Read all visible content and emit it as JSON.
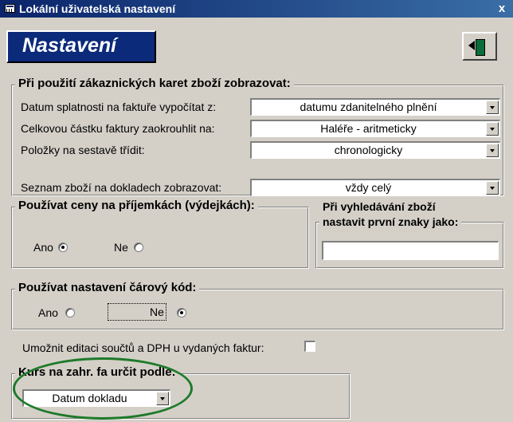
{
  "window": {
    "title": "Lokální uživatelská nastavení",
    "close_glyph": "x",
    "app_icon": "form-icon"
  },
  "header": {
    "title": "Nastavení",
    "exit_icon": "exit-door-icon"
  },
  "customer_cards_group": {
    "legend": "Při použití zákaznických karet zboží zobrazovat:",
    "rows": [
      {
        "label": "Datum splatnosti na faktuře vypočítat z:",
        "value": "datumu zdanitelného plnění"
      },
      {
        "label": "Celkovou částku faktury zaokrouhlit na:",
        "value": "Haléře - aritmeticky"
      },
      {
        "label": "Položky na sestavě třídit:",
        "value": "chronologicky"
      },
      {
        "label": "Seznam zboží na dokladech zobrazovat:",
        "value": "vždy celý"
      }
    ]
  },
  "prices_group": {
    "legend": "Používat ceny na příjemkách (výdejkách):",
    "yes_label": "Ano",
    "no_label": "Ne",
    "selected": "Ano"
  },
  "search_group": {
    "legend_line1": "Při vyhledávání zboží",
    "legend_line2": "nastavit první znaky jako:",
    "value": ""
  },
  "barcode_group": {
    "legend": "Používat nastavení čárový kód:",
    "yes_label": "Ano",
    "no_label": "Ne",
    "selected": "Ne"
  },
  "edit_totals": {
    "label": "Umožnit editaci součtů a DPH u vydaných faktur:",
    "checked": false
  },
  "exchange_group": {
    "legend": "Kurs na zahr. fa určit podle:",
    "value": "Datum dokladu"
  },
  "colors": {
    "title_bar": "#0a246a",
    "header_bg": "#0c2a7a",
    "highlight_ellipse": "#1e7a2a",
    "window_bg": "#d4d0c8"
  }
}
